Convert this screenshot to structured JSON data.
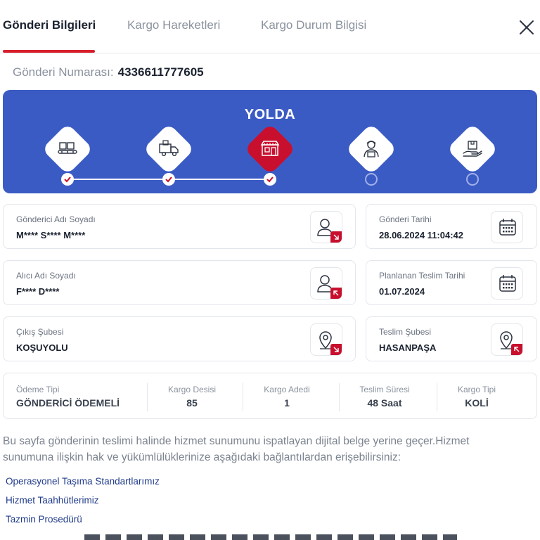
{
  "tabs": [
    {
      "label": "Gönderi Bilgileri",
      "active": true
    },
    {
      "label": "Kargo Hareketleri",
      "active": false
    },
    {
      "label": "Kargo Durum Bilgisi",
      "active": false
    }
  ],
  "shipment": {
    "number_label": "Gönderi Numarası:",
    "number": "4336611777605"
  },
  "status": {
    "title": "YOLDA",
    "accent_color": "#3b5bc4",
    "current_color": "#c8102e",
    "steps": [
      {
        "icon": "warehouse-boxes-icon",
        "done": true
      },
      {
        "icon": "delivery-truck-icon",
        "done": true
      },
      {
        "icon": "branch-store-icon",
        "done": true,
        "current": true
      },
      {
        "icon": "courier-icon",
        "done": false
      },
      {
        "icon": "hand-package-icon",
        "done": false
      }
    ]
  },
  "cards": {
    "sender": {
      "label": "Gönderici Adı Soyadı",
      "value": "M**** S**** M****",
      "icon": "user-icon"
    },
    "ship_date": {
      "label": "Gönderi Tarihi",
      "value": "28.06.2024 11:04:42",
      "icon": "calendar-icon"
    },
    "receiver": {
      "label": "Alıcı Adı Soyadı",
      "value": "F**** D****",
      "icon": "user-icon"
    },
    "planned_date": {
      "label": "Planlanan Teslim Tarihi",
      "value": "01.07.2024",
      "icon": "calendar-icon"
    },
    "origin_branch": {
      "label": "Çıkış Şubesi",
      "value": "KOŞUYOLU",
      "icon": "location-pin-icon"
    },
    "delivery_branch": {
      "label": "Teslim Şubesi",
      "value": "HASANPAŞA",
      "icon": "location-pin-icon"
    }
  },
  "summary": {
    "payment_label": "Ödeme Tipi",
    "payment_value": "GÖNDERİCİ ÖDEMELİ",
    "desi_label": "Kargo Desisi",
    "desi_value": "85",
    "count_label": "Kargo Adedi",
    "count_value": "1",
    "duration_label": "Teslim Süresi",
    "duration_value": "48 Saat",
    "type_label": "Kargo Tipi",
    "type_value": "KOLİ"
  },
  "notice": "Bu sayfa gönderinin teslimi halinde hizmet sunumunu ispatlayan dijital belge yerine geçer.Hizmet sunumuna ilişkin hak ve yükümlülüklerinize aşağıdaki bağlantılardan erişebilirsiniz:",
  "links": {
    "standards": "Operasyonel Taşıma Standartlarımız",
    "commitments": "Hizmet Taahhütlerimiz",
    "compensation": "Tazmin Prosedürü"
  }
}
